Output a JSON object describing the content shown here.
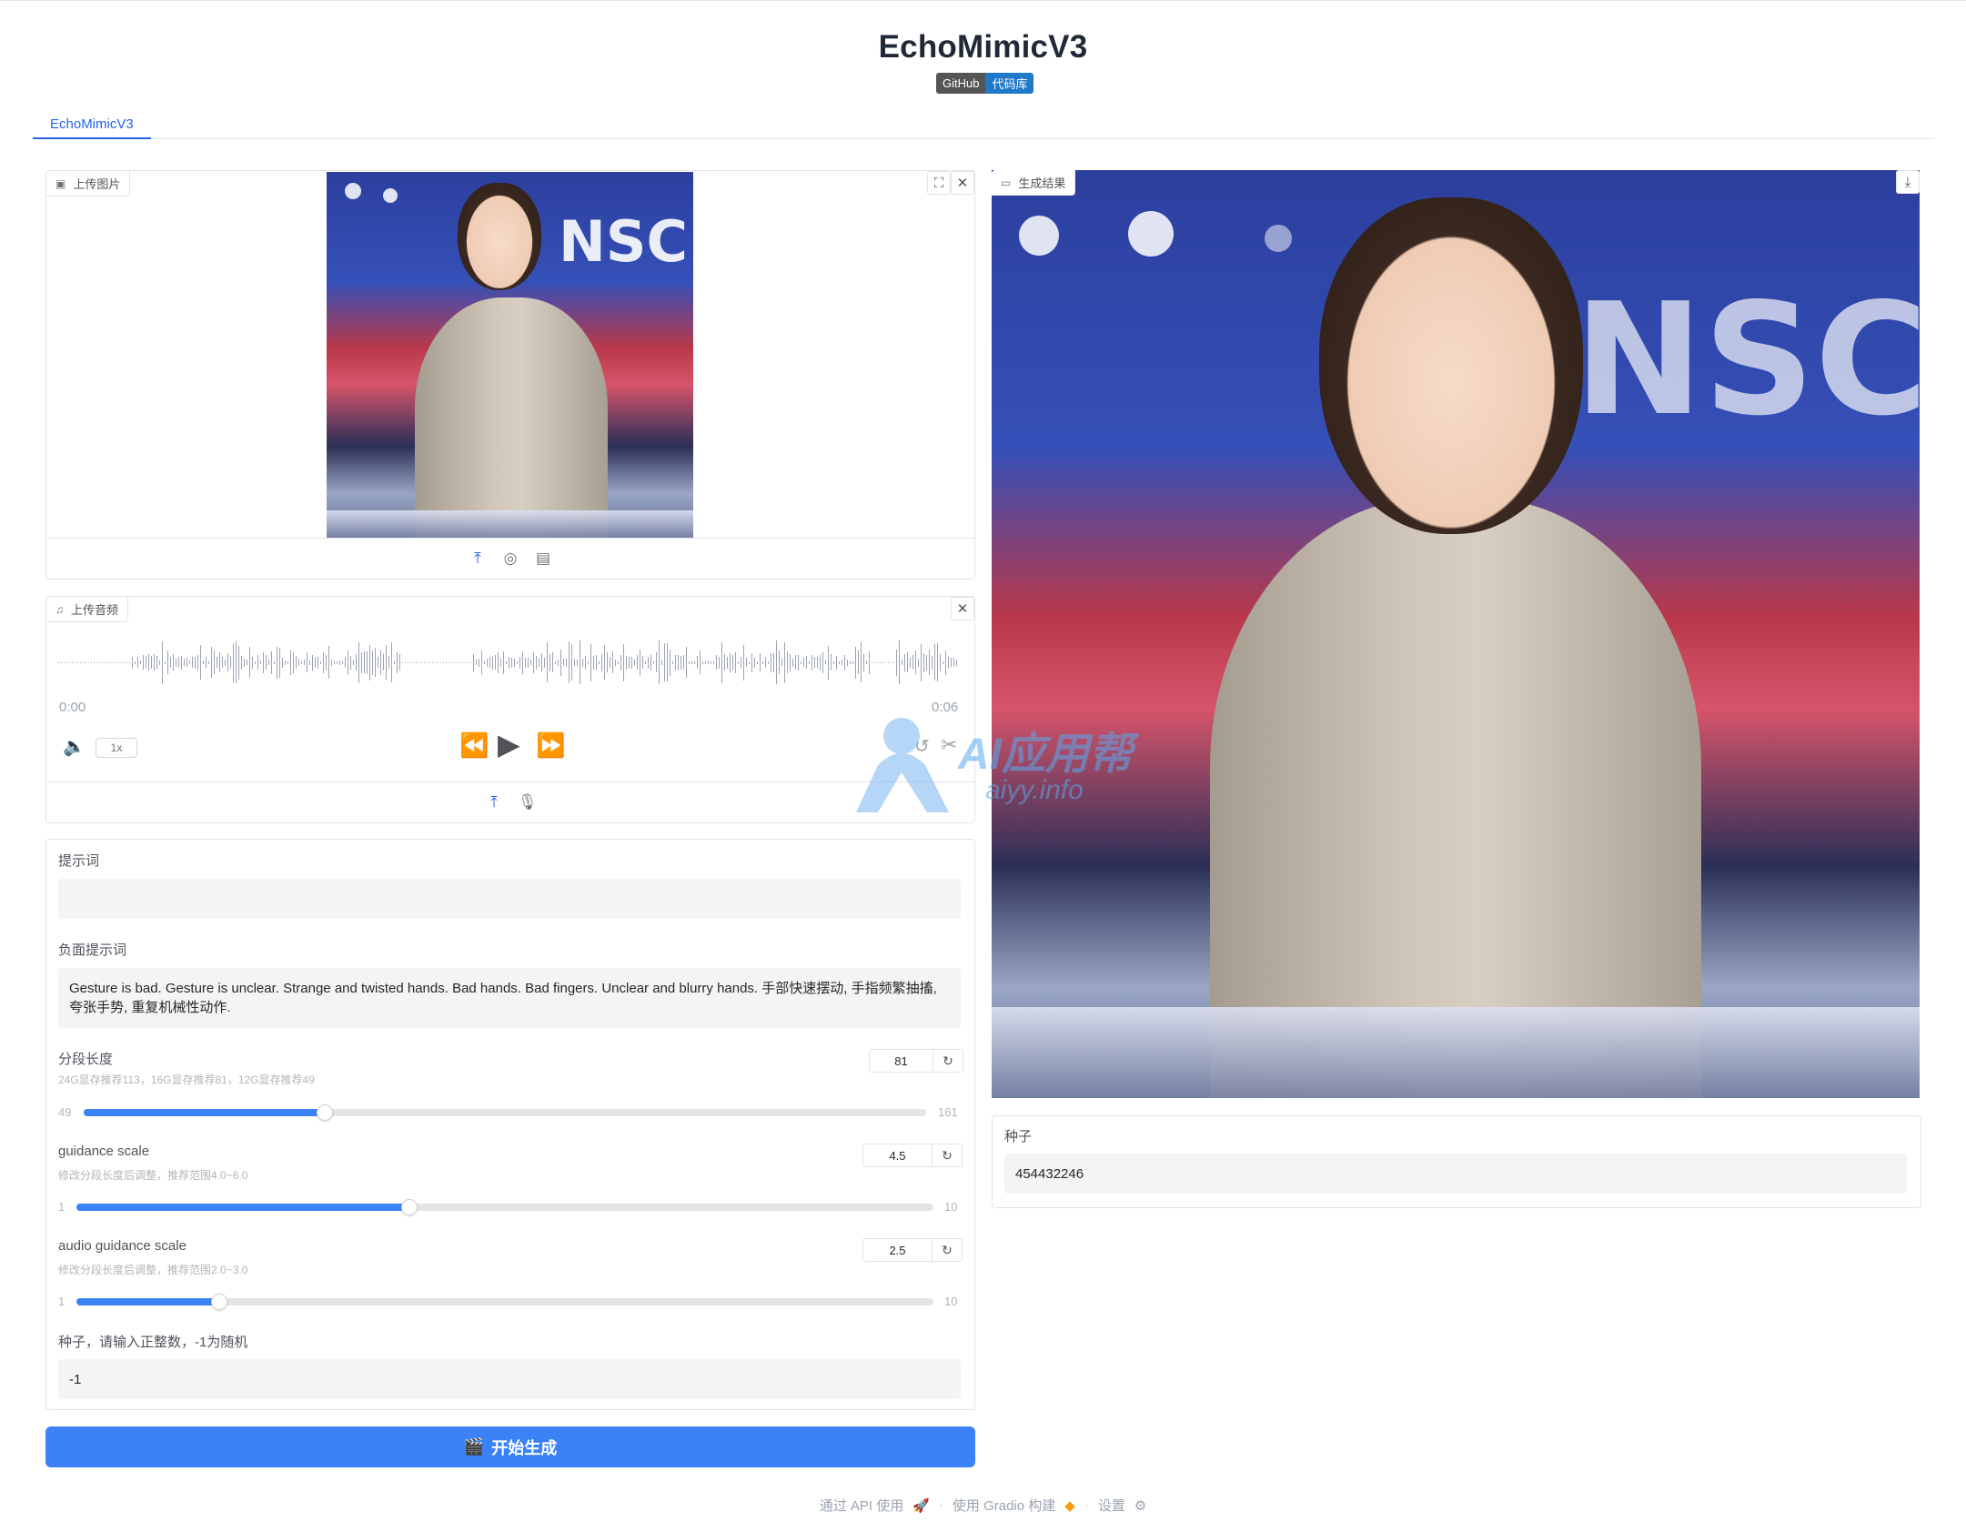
{
  "app": {
    "title": "EchoMimicV3",
    "badge_left": "GitHub",
    "badge_right": "代码库"
  },
  "tabs": [
    {
      "label": "EchoMimicV3"
    }
  ],
  "image_upload": {
    "label": "上传图片",
    "content": {
      "brand_text": "NSC"
    }
  },
  "audio_upload": {
    "label": "上传音频",
    "time_start": "0:00",
    "time_end": "0:06",
    "speed": "1x"
  },
  "form": {
    "prompt": {
      "label": "提示词",
      "value": ""
    },
    "negative_prompt": {
      "label": "负面提示词",
      "value": "Gesture is bad. Gesture is unclear. Strange and twisted hands. Bad hands. Bad fingers. Unclear and blurry hands. 手部快速摆动, 手指频繁抽搐, 夸张手势, 重复机械性动作."
    },
    "segment_length": {
      "label": "分段长度",
      "info": "24G显存推荐113，16G显存推荐81，12G显存推荐49",
      "value": "81",
      "min": "49",
      "max": "161",
      "fraction": 0.2857
    },
    "guidance_scale": {
      "label": "guidance scale",
      "info": "修改分段长度后调整，推荐范围4.0~6.0",
      "value": "4.5",
      "min": "1",
      "max": "10",
      "fraction": 0.3889
    },
    "audio_guidance_scale": {
      "label": "audio guidance scale",
      "info": "修改分段长度后调整，推荐范围2.0~3.0",
      "value": "2.5",
      "min": "1",
      "max": "10",
      "fraction": 0.1667
    },
    "seed": {
      "label": "种子，请输入正整数，-1为随机",
      "value": "-1"
    }
  },
  "generate_button": {
    "label": "开始生成"
  },
  "result": {
    "label": "生成结果",
    "seed_label": "种子",
    "seed_value": "454432246"
  },
  "footer": {
    "api": "通过 API 使用",
    "built": "使用 Gradio 构建",
    "settings": "设置"
  },
  "watermark": {
    "text1": "AI应用帮",
    "text2": "aiyy.info"
  },
  "colors": {
    "accent": "#3b82f6",
    "badge_dark": "#555555",
    "badge_blue": "#1f78c8"
  }
}
